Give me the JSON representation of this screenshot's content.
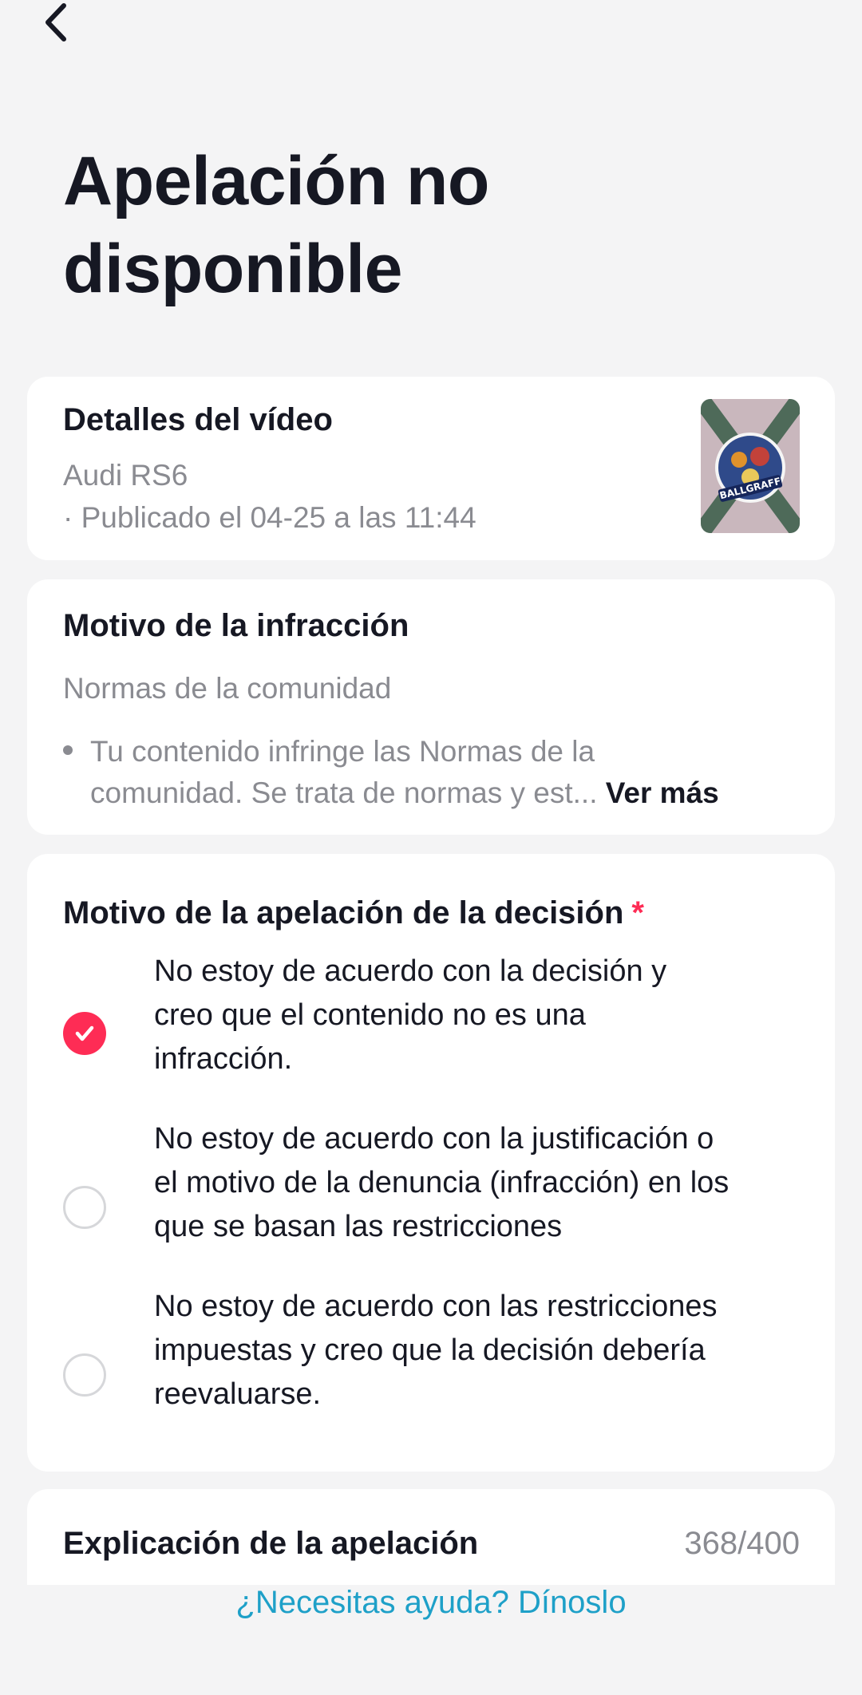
{
  "header": {
    "back_icon": "chevron-left-icon",
    "title_line1": "Apelación no",
    "title_line2": "disponible"
  },
  "video": {
    "section_title": "Detalles del vídeo",
    "name": "Audi RS6",
    "published": "· Publicado el 04-25 a las 11:44",
    "thumbnail_icon": "video-thumbnail",
    "thumbnail_text": "BALLGRAFF"
  },
  "violation": {
    "section_title": "Motivo de la infracción",
    "policy": "Normas de la comunidad",
    "description_line1": "Tu contenido infringe las Normas de la",
    "description_line2": "comunidad. Se trata de normas y est...",
    "see_more": "Ver más"
  },
  "appeal_reason": {
    "section_title": "Motivo de la apelación de la decisión",
    "required_mark": "*",
    "options": [
      {
        "line1": "No estoy de acuerdo con la decisión y",
        "line2": "creo que el contenido no es una",
        "line3": "infracción.",
        "selected": true
      },
      {
        "line1": "No estoy de acuerdo con la justificación o",
        "line2": "el motivo de la denuncia (infracción) en los",
        "line3": "que se basan las restricciones",
        "selected": false
      },
      {
        "line1": "No estoy de acuerdo con las restricciones",
        "line2": "impuestas y creo que la decisión debería",
        "line3": "reevaluarse.",
        "selected": false
      }
    ]
  },
  "explanation": {
    "section_title": "Explicación de la apelación",
    "counter": "368/400"
  },
  "footer": {
    "help_link": "¿Necesitas ayuda? Dínoslo"
  },
  "colors": {
    "accent": "#fe2c55",
    "link": "#1ea0c8",
    "background": "#f4f4f5",
    "muted_text": "#8a8b91"
  }
}
